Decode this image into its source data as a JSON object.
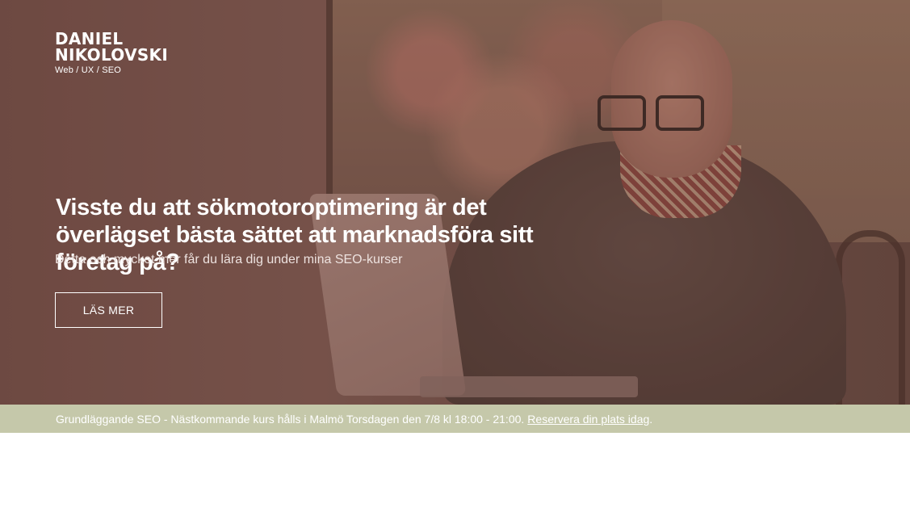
{
  "brand": {
    "name": "DANIEL NIKOLOVSKI",
    "tagline": "Web / UX / SEO"
  },
  "hero": {
    "headline": "Visste du att sökmotoroptimering är det överlägset bästa sättet att marknadsföra sitt företag på?",
    "subheadline": "Detta och mycket mer får du lära dig under mina SEO-kurser",
    "button_label": "LÄS MER"
  },
  "notice": {
    "text": "Grundläggande SEO - Nästkommande kurs hålls i Malmö Torsdagen den 7/8 kl 18:00 - 21:00.",
    "link_label": "Reservera din plats idag",
    "trailing": "."
  },
  "colors": {
    "notice_bar": "#c5c8aa",
    "hero_overlay": "#6e4b45"
  }
}
